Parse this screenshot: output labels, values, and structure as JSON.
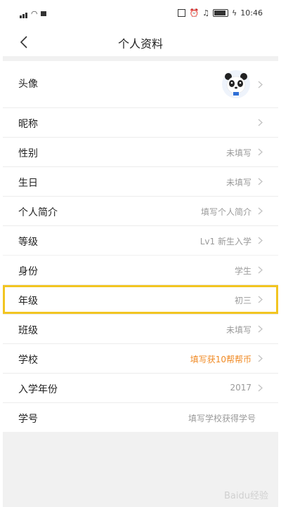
{
  "status_bar": {
    "time": "10:46"
  },
  "header": {
    "title": "个人资料"
  },
  "profile": {
    "basic": [
      {
        "label": "头像",
        "value": "",
        "type": "avatar"
      },
      {
        "label": "昵称",
        "value": ""
      },
      {
        "label": "性别",
        "value": "未填写"
      },
      {
        "label": "生日",
        "value": "未填写"
      },
      {
        "label": "个人简介",
        "value": "填写个人简介"
      },
      {
        "label": "等级",
        "value": "Lv1 新生入学"
      }
    ],
    "school": [
      {
        "label": "身份",
        "value": "学生"
      },
      {
        "label": "年级",
        "value": "初三",
        "highlighted": true
      },
      {
        "label": "班级",
        "value": "未填写"
      },
      {
        "label": "学校",
        "value": "填写获10帮帮币",
        "accent": "#f08a24"
      },
      {
        "label": "入学年份",
        "value": "2017"
      },
      {
        "label": "学号",
        "value": "填写学校获得学号"
      }
    ]
  },
  "watermark": "Baidu经验",
  "colors": {
    "highlight_border": "#f2c521",
    "accent_orange": "#f08a24",
    "page_bg": "#f1f1f1"
  }
}
